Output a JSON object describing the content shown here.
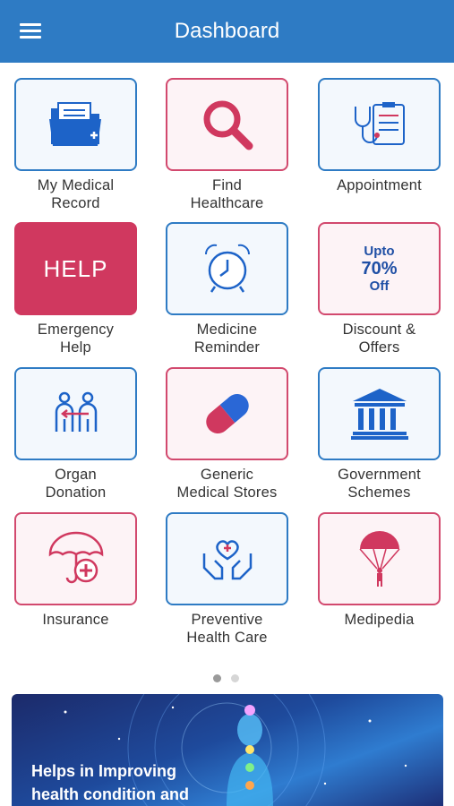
{
  "header": {
    "title": "Dashboard",
    "menu_icon": "hamburger-icon"
  },
  "tiles": [
    {
      "label": "My Medical\nRecord",
      "icon": "folder-icon"
    },
    {
      "label": "Find\nHealthcare",
      "icon": "search-icon"
    },
    {
      "label": "Appointment",
      "icon": "stethoscope-clipboard-icon"
    },
    {
      "label": "Emergency\nHelp",
      "icon": "help-icon",
      "text": "HELP"
    },
    {
      "label": "Medicine\nReminder",
      "icon": "alarm-clock-icon"
    },
    {
      "label": "Discount &\nOffers",
      "icon": "discount-icon",
      "line1": "Upto",
      "line2": "70%",
      "line3": "Off"
    },
    {
      "label": "Organ\nDonation",
      "icon": "organ-donation-icon"
    },
    {
      "label": "Generic\nMedical Stores",
      "icon": "capsule-icon"
    },
    {
      "label": "Government\nSchemes",
      "icon": "government-building-icon"
    },
    {
      "label": "Insurance",
      "icon": "umbrella-icon"
    },
    {
      "label": "Preventive\nHealth Care",
      "icon": "hands-heart-icon"
    },
    {
      "label": "Medipedia",
      "icon": "parachute-icon"
    }
  ],
  "banner": {
    "text": "Helps in Improving\nhealth condition and"
  },
  "colors": {
    "primary": "#2e7bc4",
    "accent": "#d0385f"
  }
}
